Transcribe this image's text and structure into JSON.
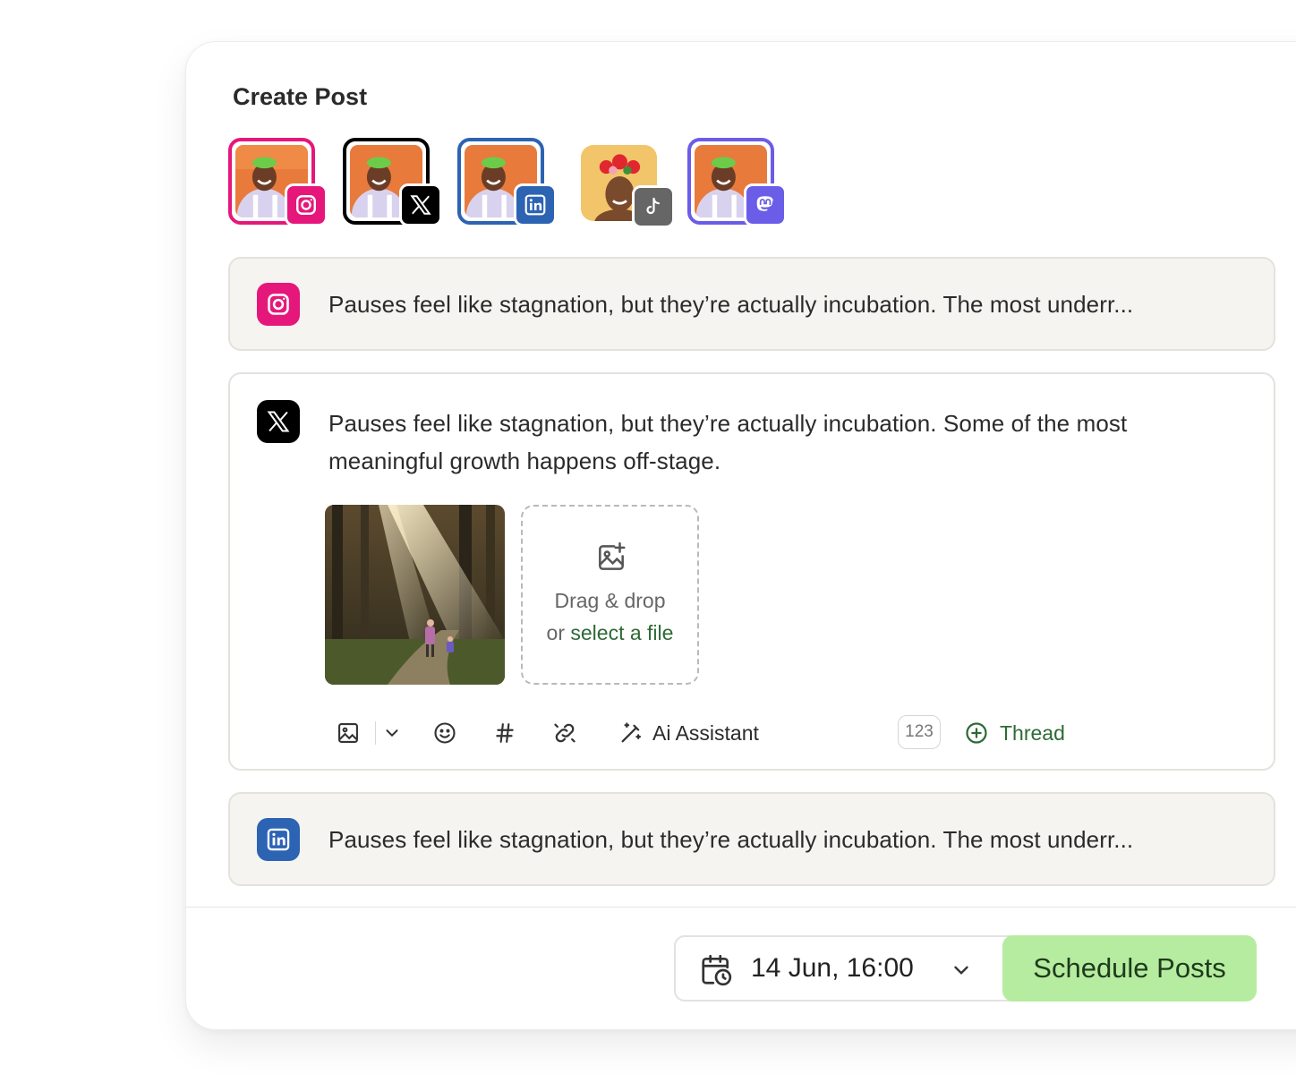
{
  "card": {
    "title": "Create Post"
  },
  "accounts": [
    {
      "network": "instagram",
      "icon": "instagram-icon",
      "color": "#e6177b"
    },
    {
      "network": "x",
      "icon": "x-icon",
      "color": "#000000"
    },
    {
      "network": "linkedin",
      "icon": "linkedin-icon",
      "color": "#2d63b3"
    },
    {
      "network": "tiktok",
      "icon": "tiktok-icon",
      "color": "#666666"
    },
    {
      "network": "mastodon",
      "icon": "mastodon-icon",
      "color": "#6a5de8"
    }
  ],
  "posts": {
    "instagram": {
      "text": "Pauses feel like stagnation, but they’re actually incubation. The most underr..."
    },
    "x": {
      "text": "Pauses feel like stagnation, but they’re actually incubation. Some of the most meaningful growth happens off-stage."
    },
    "linkedin": {
      "text": "Pauses feel like stagnation, but they’re actually incubation. The most underr..."
    }
  },
  "upload": {
    "line1": "Drag & drop",
    "line2_prefix": "or ",
    "line2_link": "select a file"
  },
  "toolbar": {
    "ai_label": "Ai Assistant",
    "counter": "123",
    "thread_label": "Thread"
  },
  "footer": {
    "datetime": "14 Jun, 16:00",
    "schedule_label": "Schedule Posts"
  },
  "colors": {
    "accent_green": "#2d6a35",
    "schedule_bg": "#b6ec9f"
  }
}
